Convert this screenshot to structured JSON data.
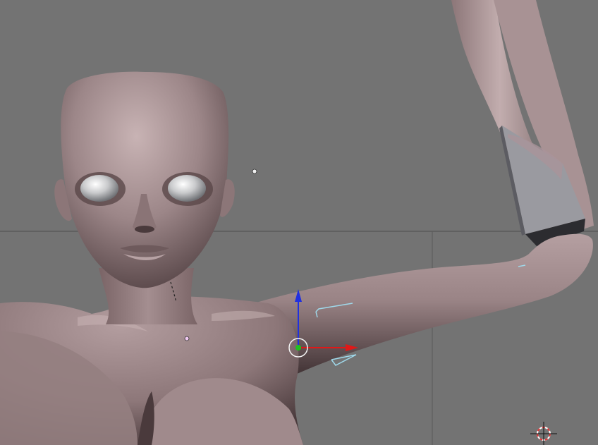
{
  "viewport": {
    "background": "#737373",
    "grid_line_color": "#4e4e4e"
  },
  "model": {
    "skin_color": "#9c8688",
    "skin_highlight": "#c7b2b3",
    "skin_shadow": "#3a2c2e",
    "eye_color": "#c9cacc",
    "selected_face_color": "#9a9aa0"
  },
  "manipulator": {
    "x_axis_color": "#e01818",
    "y_axis_color": "#20c020",
    "z_axis_color": "#2030e0",
    "center_ring_color": "#f4f4f4"
  },
  "lamp_color": "#f0f0f0",
  "bone_color": "#9fd8ea",
  "cursor_3d": {
    "ring_color_a": "#e03030",
    "ring_color_b": "#ffffff",
    "crosshair_color": "#101010"
  }
}
